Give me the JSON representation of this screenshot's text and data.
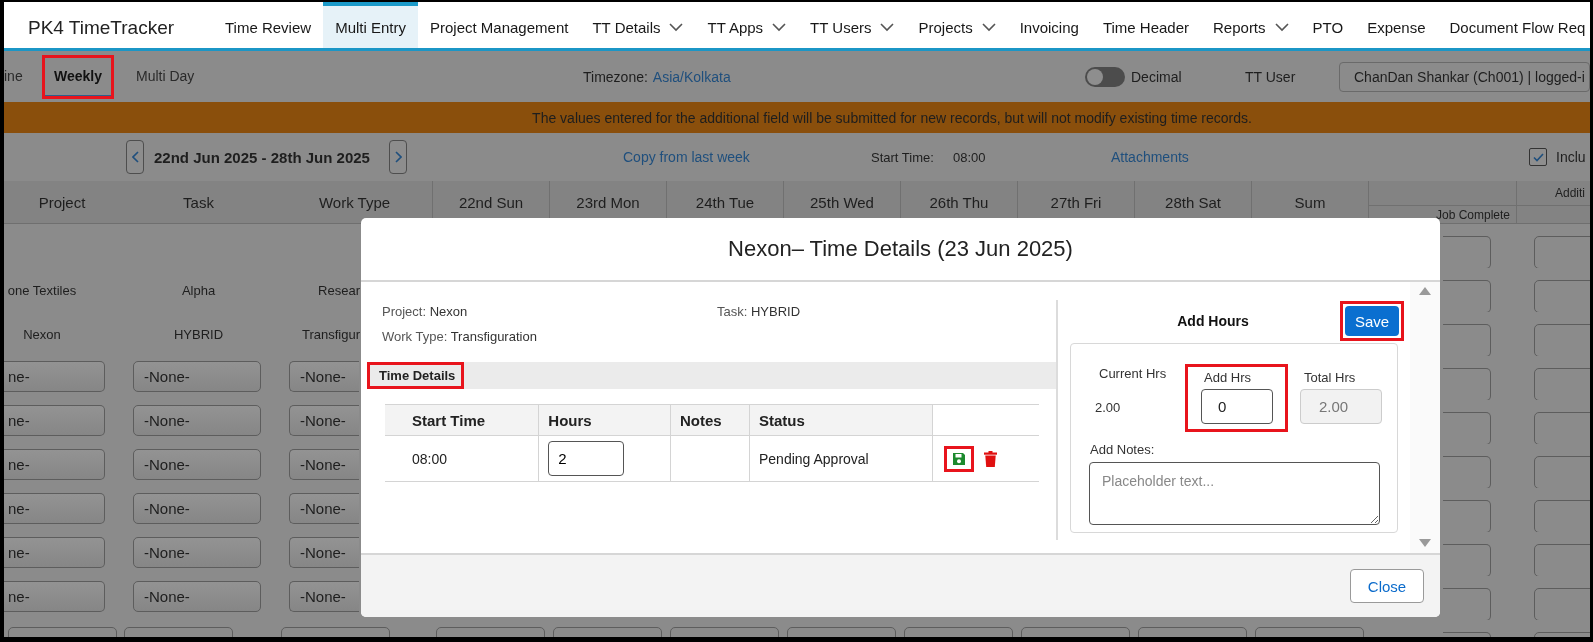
{
  "app": {
    "title": "PK4 TimeTracker"
  },
  "nav": [
    {
      "label": "Time Review",
      "selected": false,
      "dropdown": false
    },
    {
      "label": "Multi Entry",
      "selected": true,
      "dropdown": false
    },
    {
      "label": "Project Management",
      "selected": false,
      "dropdown": false
    },
    {
      "label": "TT Details",
      "selected": false,
      "dropdown": true
    },
    {
      "label": "TT Apps",
      "selected": false,
      "dropdown": true
    },
    {
      "label": "TT Users",
      "selected": false,
      "dropdown": true
    },
    {
      "label": "Projects",
      "selected": false,
      "dropdown": true
    },
    {
      "label": "Invoicing",
      "selected": false,
      "dropdown": false
    },
    {
      "label": "Time Header",
      "selected": false,
      "dropdown": false
    },
    {
      "label": "Reports",
      "selected": false,
      "dropdown": true
    },
    {
      "label": "PTO",
      "selected": false,
      "dropdown": false
    },
    {
      "label": "Expense",
      "selected": false,
      "dropdown": false
    },
    {
      "label": "Document Flow Req",
      "selected": false,
      "dropdown": false
    }
  ],
  "subtabs": [
    {
      "label": "ine",
      "selected": false,
      "highlighted": false
    },
    {
      "label": "Weekly",
      "selected": true,
      "highlighted": true
    },
    {
      "label": "Multi Day",
      "selected": false,
      "highlighted": false
    }
  ],
  "timezone": {
    "label": "Timezone:",
    "value": "Asia/Kolkata"
  },
  "decimal_toggle": {
    "label": "Decimal",
    "on": false
  },
  "tt_user": {
    "label": "TT User",
    "value": "ChanDan Shankar (Ch001) | logged-i"
  },
  "banner": "The values entered for the additional field will be submitted for new records, but will not modify existing time records.",
  "week": {
    "range": "22nd Jun 2025 - 28th Jun 2025",
    "copy_link": "Copy from last week",
    "start_time_label": "Start Time:",
    "start_time": "08:00",
    "attachments": "Attachments",
    "include": {
      "label": "Inclu",
      "checked": true
    }
  },
  "grid": {
    "columns": [
      "Project",
      "Task",
      "Work Type",
      "22nd Sun",
      "23rd Mon",
      "24th Tue",
      "25th Wed",
      "26th Thu",
      "27th Fri",
      "28th Sat",
      "Sum"
    ],
    "group_header": "Additi",
    "subcolumn": "Job Complete",
    "rows": [
      {
        "kind": "blank"
      },
      {
        "kind": "text",
        "cells": [
          "one Textiles",
          "Alpha",
          "Resear"
        ]
      },
      {
        "kind": "text",
        "cells": [
          "Nexon",
          "HYBRID",
          "Transfigur"
        ]
      },
      {
        "kind": "select",
        "cells": [
          "ne-",
          "-None-",
          "-None-"
        ]
      },
      {
        "kind": "select",
        "cells": [
          "ne-",
          "-None-",
          "-None-"
        ]
      },
      {
        "kind": "select",
        "cells": [
          "ne-",
          "-None-",
          "-None-"
        ]
      },
      {
        "kind": "select",
        "cells": [
          "ne-",
          "-None-",
          "-None-"
        ]
      },
      {
        "kind": "select",
        "cells": [
          "ne-",
          "-None-",
          "-None-"
        ]
      },
      {
        "kind": "select",
        "cells": [
          "ne-",
          "-None-",
          "-None-"
        ]
      }
    ]
  },
  "modal": {
    "title": "Nexon– Time Details (23 Jun 2025)",
    "info": [
      {
        "label": "Project:",
        "value": "Nexon"
      },
      {
        "label": "Task:",
        "value": "HYBRID"
      },
      {
        "label": "Work Type:",
        "value": "Transfiguration"
      }
    ],
    "section": {
      "label": "Time Details",
      "highlighted": true
    },
    "entries": {
      "columns": [
        "Start Time",
        "Hours",
        "Notes",
        "Status"
      ],
      "rows": [
        {
          "start": "08:00",
          "hours": "2",
          "status": "Pending Approval",
          "save_highlighted": true
        }
      ]
    },
    "add_hours": {
      "title": "Add Hours",
      "save": {
        "label": "Save",
        "highlighted": true
      },
      "current": {
        "label": "Current Hrs",
        "value": "2.00"
      },
      "add": {
        "label": "Add Hrs",
        "value": "0",
        "highlighted": true
      },
      "total": {
        "label": "Total Hrs",
        "value": "2.00",
        "disabled": true
      },
      "notes": {
        "label": "Add Notes:",
        "placeholder": "Placeholder text..."
      }
    },
    "close": "Close"
  }
}
